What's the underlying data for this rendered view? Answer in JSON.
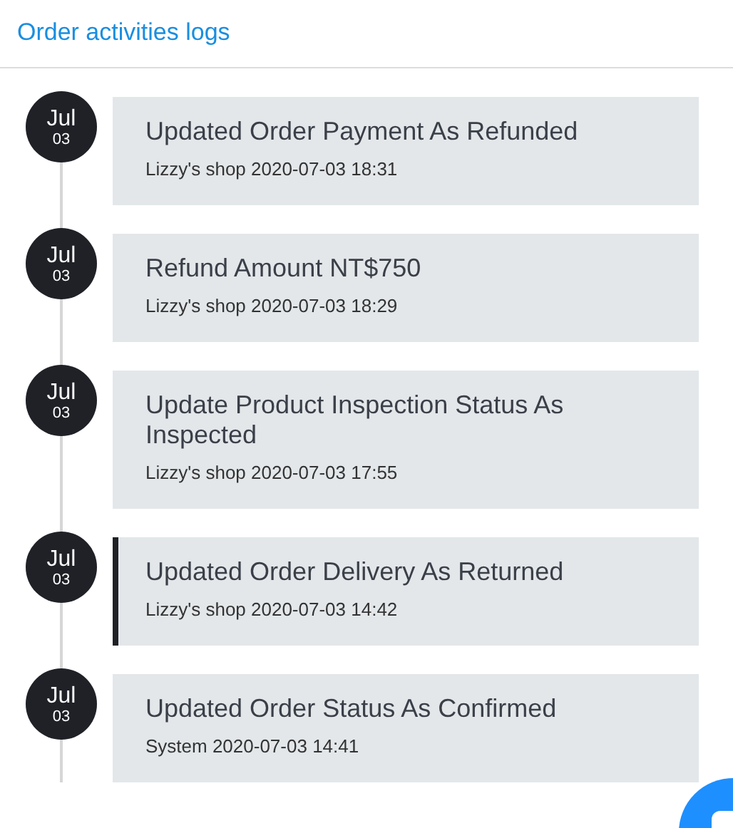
{
  "header": {
    "title": "Order activities logs"
  },
  "activities": [
    {
      "month": "Jul",
      "day": "03",
      "title": "Updated Order Payment As Refunded",
      "meta": "Lizzy's shop 2020-07-03 18:31",
      "selected": false
    },
    {
      "month": "Jul",
      "day": "03",
      "title": "Refund Amount NT$750",
      "meta": "Lizzy's shop 2020-07-03 18:29",
      "selected": false
    },
    {
      "month": "Jul",
      "day": "03",
      "title": "Update Product Inspection Status As Inspected",
      "meta": "Lizzy's shop 2020-07-03 17:55",
      "selected": false
    },
    {
      "month": "Jul",
      "day": "03",
      "title": "Updated Order Delivery As Returned",
      "meta": "Lizzy's shop 2020-07-03 14:42",
      "selected": true
    },
    {
      "month": "Jul",
      "day": "03",
      "title": "Updated Order Status As Confirmed",
      "meta": "System 2020-07-03 14:41",
      "selected": false
    }
  ]
}
